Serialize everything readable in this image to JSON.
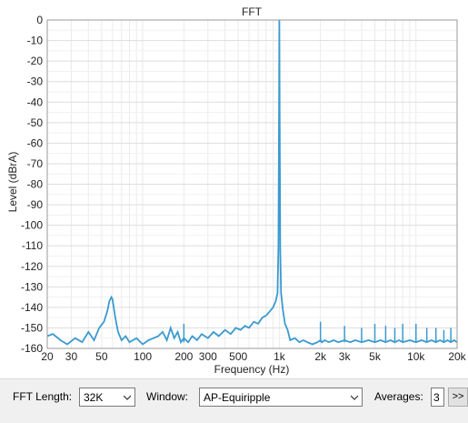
{
  "chart_data": {
    "type": "line",
    "title": "FFT",
    "xlabel": "Frequency (Hz)",
    "ylabel": "Level (dBrA)",
    "xscale": "log",
    "xlim": [
      20,
      20000
    ],
    "ylim": [
      -160,
      0
    ],
    "grid": true,
    "line_color": "#3a9ad0",
    "x_ticks": [
      20,
      30,
      50,
      100,
      200,
      300,
      500,
      1000,
      2000,
      3000,
      5000,
      10000,
      20000
    ],
    "x_tick_labels": [
      "20",
      "30",
      "50",
      "100",
      "200",
      "300",
      "500",
      "1k",
      "2k",
      "3k",
      "5k",
      "10k",
      "20k"
    ],
    "y_ticks": [
      0,
      -10,
      -20,
      -30,
      -40,
      -50,
      -60,
      -70,
      -80,
      -90,
      -100,
      -110,
      -120,
      -130,
      -140,
      -150,
      -160
    ],
    "y_tick_labels": [
      "0",
      "-10",
      "-20",
      "-30",
      "-40",
      "-50",
      "-60",
      "-70",
      "-80",
      "-90",
      "-100",
      "-110",
      "-120",
      "-130",
      "-140",
      "-150",
      "-160"
    ],
    "series": [
      {
        "x": [
          20,
          22,
          25,
          28,
          32,
          36,
          40,
          44,
          48,
          52,
          55,
          57,
          59,
          60,
          61,
          63,
          66,
          70,
          75,
          80,
          90,
          100,
          110,
          120,
          130,
          140,
          150,
          160,
          170,
          180,
          190,
          200,
          215,
          230,
          250,
          270,
          300,
          330,
          360,
          400,
          440,
          480,
          520,
          560,
          600,
          650,
          700,
          750,
          800,
          850,
          900,
          940,
          970,
          985,
          995,
          1000,
          1005,
          1015,
          1030,
          1060,
          1100,
          1150,
          1200,
          1300,
          1400,
          1500,
          1600,
          1750,
          1900,
          2000,
          2050,
          2150,
          2300,
          2500,
          2700,
          3000,
          3300,
          3600,
          4000,
          4500,
          5000,
          5500,
          6000,
          6500,
          7000,
          7500,
          8000,
          9000,
          10000,
          11000,
          12000,
          13000,
          14000,
          15000,
          16000,
          17000,
          18000,
          19000,
          20000
        ],
        "y": [
          -154,
          -153,
          -156,
          -158,
          -155,
          -157,
          -152,
          -156,
          -150,
          -147,
          -142,
          -137,
          -135,
          -136,
          -139,
          -145,
          -152,
          -156,
          -154,
          -157,
          -155,
          -158,
          -156,
          -155,
          -154,
          -152,
          -156,
          -150,
          -155,
          -152,
          -157,
          -155,
          -157,
          -154,
          -156,
          -153,
          -155,
          -152,
          -154,
          -151,
          -153,
          -150,
          -151,
          -149,
          -150,
          -147,
          -148,
          -145,
          -144,
          -142,
          -140,
          -137,
          -133,
          -110,
          -40,
          0,
          -40,
          -112,
          -133,
          -141,
          -148,
          -151,
          -156,
          -155,
          -157,
          -156,
          -157,
          -158,
          -157,
          -156,
          -157,
          -156,
          -157,
          -156,
          -157,
          -156,
          -157,
          -156,
          -157,
          -156,
          -157,
          -156,
          -157,
          -156,
          -157,
          -156,
          -157,
          -156,
          -157,
          -156,
          -157,
          -156,
          -157,
          -156,
          -157,
          -156,
          -157,
          -156,
          -157
        ]
      }
    ],
    "spikes": [
      {
        "x": 200,
        "y": -148
      },
      {
        "x": 2000,
        "y": -147
      },
      {
        "x": 3000,
        "y": -149
      },
      {
        "x": 4000,
        "y": -150
      },
      {
        "x": 5000,
        "y": -148
      },
      {
        "x": 6000,
        "y": -149
      },
      {
        "x": 7000,
        "y": -150
      },
      {
        "x": 8000,
        "y": -148
      },
      {
        "x": 10000,
        "y": -148
      },
      {
        "x": 12000,
        "y": -150
      },
      {
        "x": 14000,
        "y": -150
      },
      {
        "x": 16000,
        "y": -151
      },
      {
        "x": 18000,
        "y": -150
      }
    ]
  },
  "toolbar": {
    "fft_length_label": "FFT Length:",
    "fft_length_value": "32K",
    "window_label": "Window:",
    "window_value": "AP-Equiripple",
    "averages_label": "Averages:",
    "averages_value": "3",
    "more_label": ">>"
  }
}
